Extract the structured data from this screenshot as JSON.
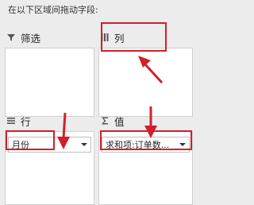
{
  "instruction": "在以下区域间拖动字段:",
  "areas": {
    "filters": {
      "label": "筛选",
      "icon": "filter-icon"
    },
    "columns": {
      "label": "列",
      "icon": "columns-icon"
    },
    "rows": {
      "label": "行",
      "icon": "rows-icon",
      "fields": [
        "月份"
      ]
    },
    "values": {
      "label": "值",
      "icon": "sigma-icon",
      "fields": [
        "求和项:订单数..."
      ]
    }
  },
  "colors": {
    "highlight": "#d0202a",
    "background": "#ececec",
    "box": "#ffffff"
  }
}
